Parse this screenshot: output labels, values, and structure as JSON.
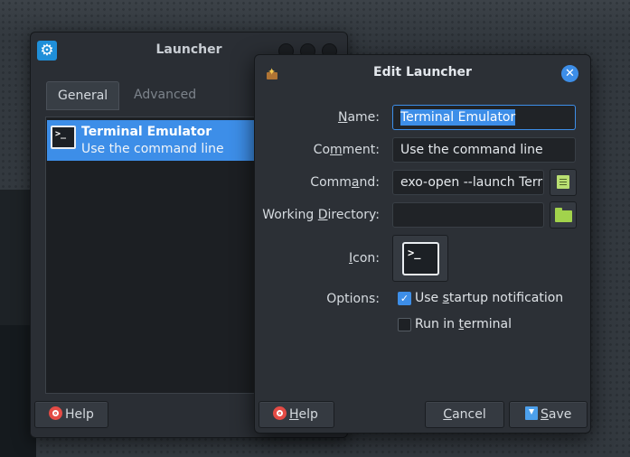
{
  "launcher": {
    "title": "Launcher",
    "tabs": [
      {
        "label": "General",
        "active": true
      },
      {
        "label": "Advanced",
        "active": false
      }
    ],
    "items": [
      {
        "name": "Terminal Emulator",
        "description": "Use the command line",
        "icon": "terminal-icon",
        "selected": true
      }
    ],
    "help_label": "Help"
  },
  "dialog": {
    "title": "Edit Launcher",
    "fields": {
      "name": {
        "label": "Name:",
        "label_underline": "N",
        "label_rest": "ame:",
        "value": "Terminal Emulator"
      },
      "comment": {
        "label": "Comment:",
        "label_pre": "Co",
        "label_underline": "m",
        "label_rest": "ment:",
        "value": "Use the command line"
      },
      "command": {
        "label": "Command:",
        "label_pre": "Comm",
        "label_underline": "a",
        "label_rest": "nd:",
        "value": "exo-open --launch Terr"
      },
      "working_directory": {
        "label": "Working Directory:",
        "label_pre": "Working ",
        "label_underline": "D",
        "label_rest": "irectory:",
        "value": ""
      },
      "icon": {
        "label": "Icon:",
        "label_underline": "I",
        "label_rest": "con:",
        "value": "terminal-icon"
      }
    },
    "options": {
      "label": "Options:",
      "startup_notification": {
        "pre": "Use ",
        "underline": "s",
        "rest": "tartup notification",
        "checked": true
      },
      "run_in_terminal": {
        "pre": "Run in ",
        "underline": "t",
        "rest": "erminal",
        "checked": false
      }
    },
    "buttons": {
      "help": {
        "underline": "H",
        "rest": "elp"
      },
      "cancel": {
        "underline": "C",
        "rest": "ancel"
      },
      "save": {
        "underline": "S",
        "rest": "ave"
      }
    }
  },
  "colors": {
    "accent": "#3d8ee8",
    "window_bg": "#2a2e34",
    "field_bg": "#202327"
  }
}
